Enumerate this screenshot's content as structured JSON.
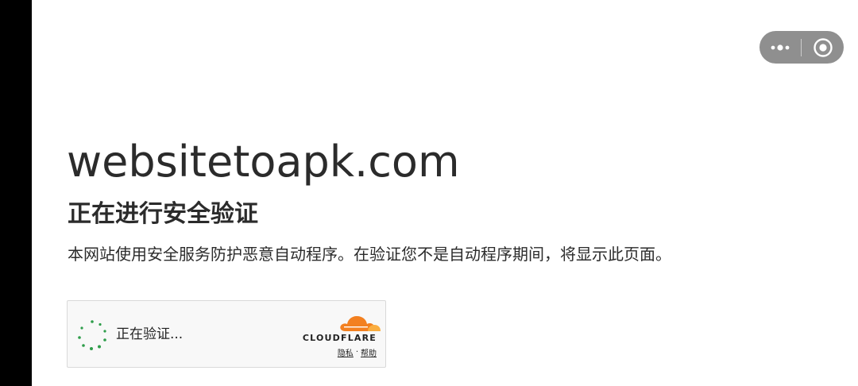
{
  "app_chrome": {
    "more_icon": "more-dots-icon",
    "close_icon": "target-close-icon",
    "capsule_color": "#8f8f8f"
  },
  "page": {
    "site_title": "websitetoapk.com",
    "heading": "正在进行安全验证",
    "description": "本网站使用安全服务防护恶意自动程序。在验证您不是自动程序期间，将显示此页面。"
  },
  "widget": {
    "status_text": "正在验证...",
    "brand": "CLOUDFLARE",
    "privacy_link": "隐私",
    "separator": "·",
    "help_link": "帮助",
    "spinner_color": "#2e9d4a",
    "logo_color": "#f38020"
  }
}
